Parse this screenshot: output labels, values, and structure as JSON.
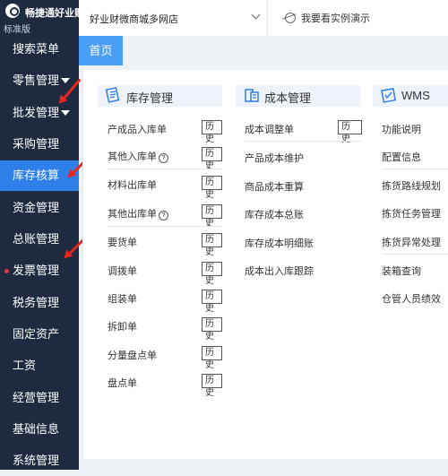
{
  "brand": {
    "name": "畅捷通好业财",
    "edition": "标准版"
  },
  "sidebar": {
    "items": [
      {
        "label": "搜索菜单"
      },
      {
        "label": "零售管理"
      },
      {
        "label": "批发管理"
      },
      {
        "label": "采购管理"
      },
      {
        "label": "库存核算"
      },
      {
        "label": "资金管理"
      },
      {
        "label": "总账管理"
      },
      {
        "label": "发票管理"
      },
      {
        "label": "税务管理"
      },
      {
        "label": "固定资产"
      },
      {
        "label": "工资"
      },
      {
        "label": "经营管理"
      },
      {
        "label": "基础信息"
      },
      {
        "label": "系统管理"
      }
    ],
    "active_index": 4,
    "accent_color": "#2f7fe8",
    "background_color": "#1d2a3f"
  },
  "topbar": {
    "store_name": "好业财微商城多网店",
    "demo_link": "我要看实例演示"
  },
  "tabs": [
    {
      "label": "首页"
    }
  ],
  "columns": [
    {
      "title": "库存管理",
      "icon": "inventory-icon",
      "items": [
        {
          "label": "产成品入库单",
          "history": "历史"
        },
        {
          "label": "其他入库单",
          "history": "历史",
          "help": "?"
        },
        {
          "label": "材料出库单",
          "history": "历史"
        },
        {
          "label": "其他出库单",
          "history": "历史",
          "help": "?"
        },
        {
          "label": "要货单",
          "history": "历史"
        },
        {
          "label": "调拨单",
          "history": "历史"
        },
        {
          "label": "组装单",
          "history": "历史"
        },
        {
          "label": "拆卸单",
          "history": "历史"
        },
        {
          "label": "分量盘点单",
          "history": "历史"
        },
        {
          "label": "盘点单",
          "history": "历史"
        }
      ]
    },
    {
      "title": "成本管理",
      "icon": "cost-icon",
      "items": [
        {
          "label": "成本调整单",
          "history": "历史"
        },
        {
          "label": "产品成本维护"
        },
        {
          "label": "商品成本重算"
        },
        {
          "label": "库存成本总账"
        },
        {
          "label": "库存成本明细账"
        },
        {
          "label": "成本出入库跟踪"
        }
      ]
    },
    {
      "title": "WMS",
      "icon": "wms-icon",
      "items": [
        {
          "label": "功能说明"
        },
        {
          "label": "配置信息"
        },
        {
          "label": "拣货路线规划"
        },
        {
          "label": "拣货任务管理"
        },
        {
          "label": "拣货异常处理"
        },
        {
          "label": "装箱查询"
        },
        {
          "label": "仓管人员绩效"
        }
      ]
    }
  ],
  "colors": {
    "annotation_red": "#e8251f",
    "home_tab": "#4b9ef5",
    "header_bg": "#edf2fb"
  }
}
